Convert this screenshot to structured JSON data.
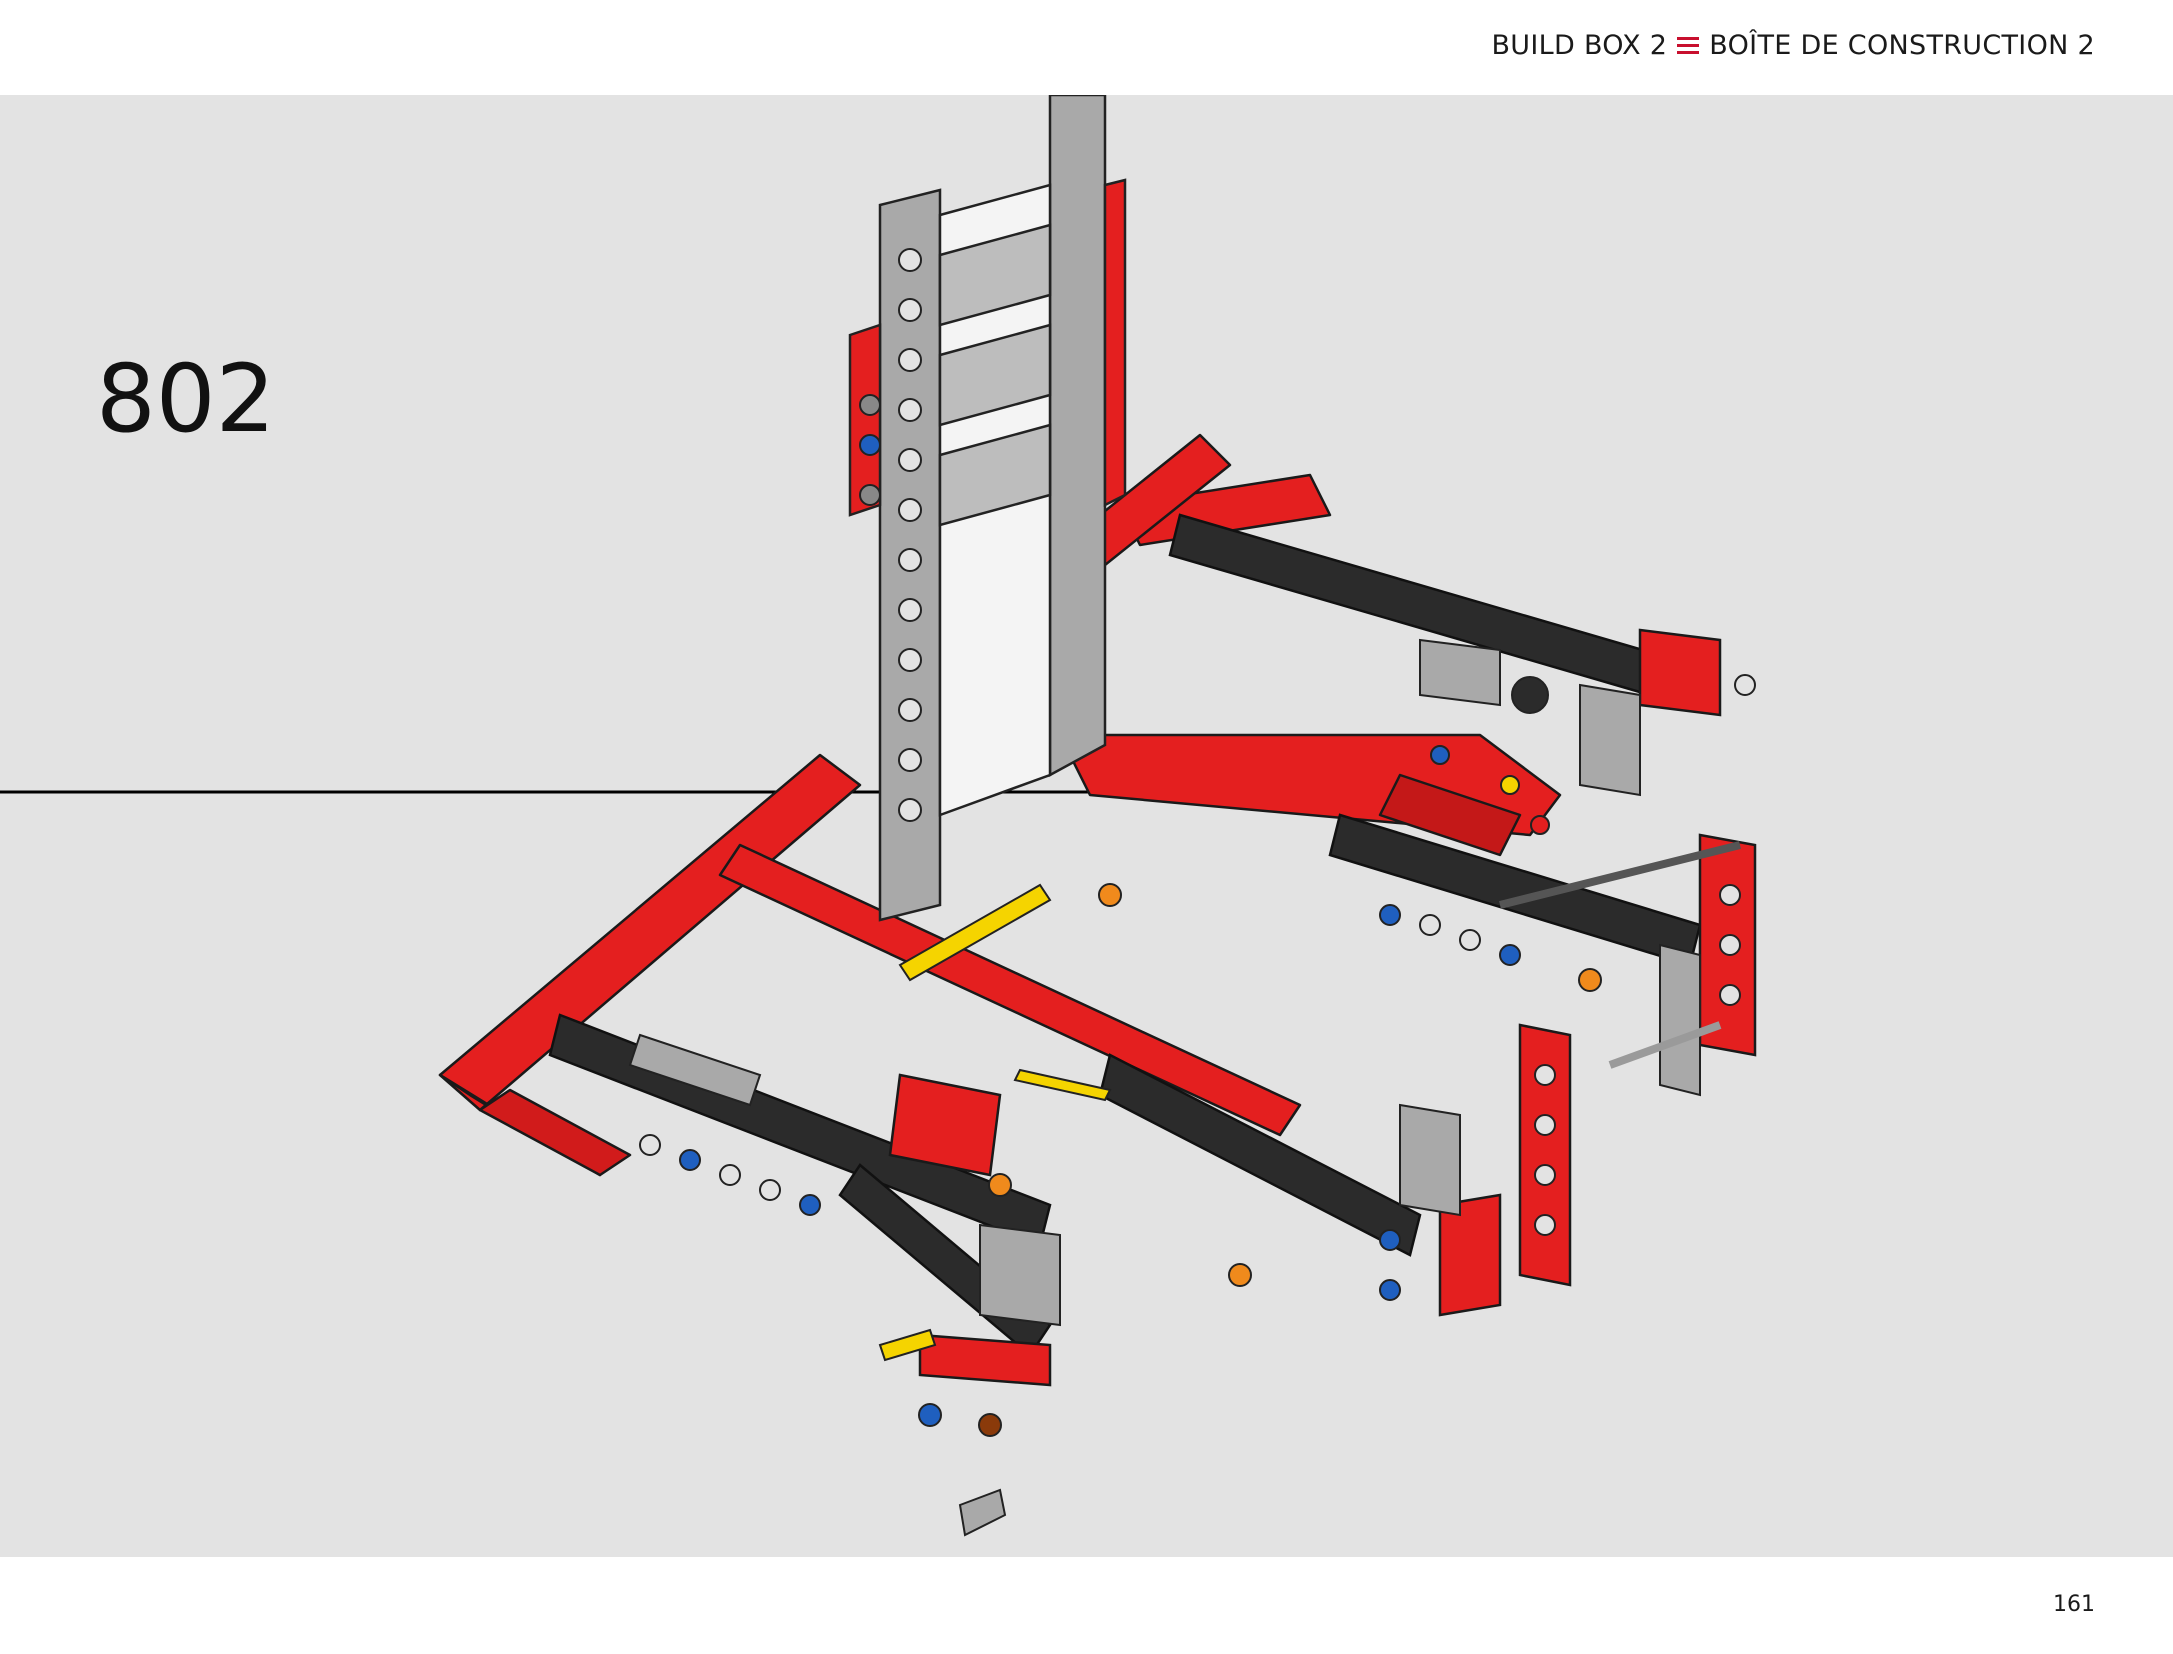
{
  "header": {
    "title_en": "BUILD BOX 2",
    "title_fr": "BOÎTE DE CONSTRUCTION 2",
    "separator_icon": "triple-bar-icon",
    "accent_color": "#c8102e"
  },
  "step": {
    "number": "802"
  },
  "footer": {
    "page_number": "161"
  },
  "colors": {
    "background": "#e3e3e3",
    "red": "#e41f1f",
    "dark_gray": "#2b2b2b",
    "light_gray": "#a9a9a9",
    "blue": "#1f5fbf",
    "orange": "#f08a1c",
    "yellow": "#f5d400"
  }
}
